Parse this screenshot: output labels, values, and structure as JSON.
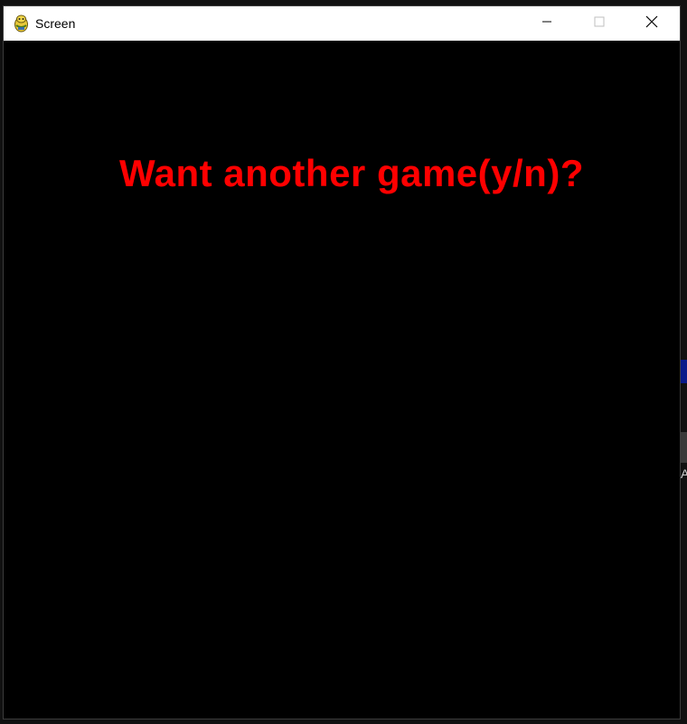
{
  "window": {
    "title": "Screen",
    "app_icon": "pygame-snake-icon",
    "controls": {
      "minimize_icon": "minimize-icon",
      "maximize_icon": "maximize-icon",
      "close_icon": "close-icon"
    }
  },
  "game": {
    "prompt_text": "Want another game(y/n)?",
    "prompt_color": "#ff0000",
    "background_color": "#000000"
  },
  "background": {
    "partial_letter": "A"
  }
}
